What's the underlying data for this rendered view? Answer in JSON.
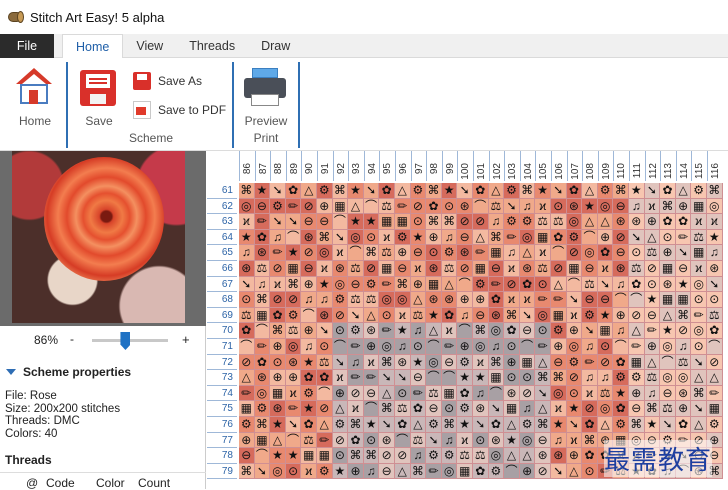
{
  "window": {
    "title": "Stitch Art Easy! 5 alpha",
    "icon": "thread-spool-icon"
  },
  "tabs": [
    {
      "label": "File"
    },
    {
      "label": "Home"
    },
    {
      "label": "View"
    },
    {
      "label": "Threads"
    },
    {
      "label": "Draw"
    }
  ],
  "ribbon": {
    "home_label": "Home",
    "save_label": "Save",
    "save_as_label": "Save As",
    "save_pdf_label": "Save to PDF",
    "scheme_group": "Scheme",
    "preview_label": "Preview",
    "print_group": "Print"
  },
  "preview": {
    "zoom": "86%",
    "zoom_minus": "-",
    "zoom_plus": "+",
    "zoom_fraction": 0.44
  },
  "scheme": {
    "header": "Scheme properties",
    "file": "File: Rose",
    "size": "Size: 200x200 stitches",
    "threads": "Threads: DMC",
    "colors": "Colors: 40"
  },
  "threads_panel": {
    "header": "Threads",
    "columns": [
      "@",
      "Code",
      "Color",
      "Count"
    ]
  },
  "grid": {
    "columns": [
      "86",
      "87",
      "88",
      "89",
      "90",
      "91",
      "92",
      "93",
      "94",
      "95",
      "96",
      "97",
      "98",
      "99",
      "100",
      "101",
      "102",
      "103",
      "104",
      "105",
      "106",
      "107",
      "108",
      "109",
      "110",
      "111",
      "112",
      "113",
      "114",
      "115",
      "116"
    ],
    "rows": [
      "61",
      "62",
      "63",
      "64",
      "65",
      "66",
      "67",
      "68",
      "69",
      "70",
      "71",
      "72",
      "73",
      "74",
      "75",
      "76",
      "77",
      "78",
      "79"
    ],
    "symbols": [
      "⌘",
      "✏",
      "⚖",
      "★",
      "⊕",
      "⊘",
      "➘",
      "◎",
      "▦",
      "✿",
      "♫",
      "⊖",
      "△",
      "⊙",
      "ϰ",
      "⚙",
      "⌒",
      "⊛"
    ],
    "colors": [
      "#f0a98a",
      "#e8896f",
      "#f3b9a0",
      "#d66b5c",
      "#c9b7b8",
      "#a8a0a4",
      "#e0c4bd",
      "#f7c6b0"
    ]
  },
  "watermark": "最需教育"
}
